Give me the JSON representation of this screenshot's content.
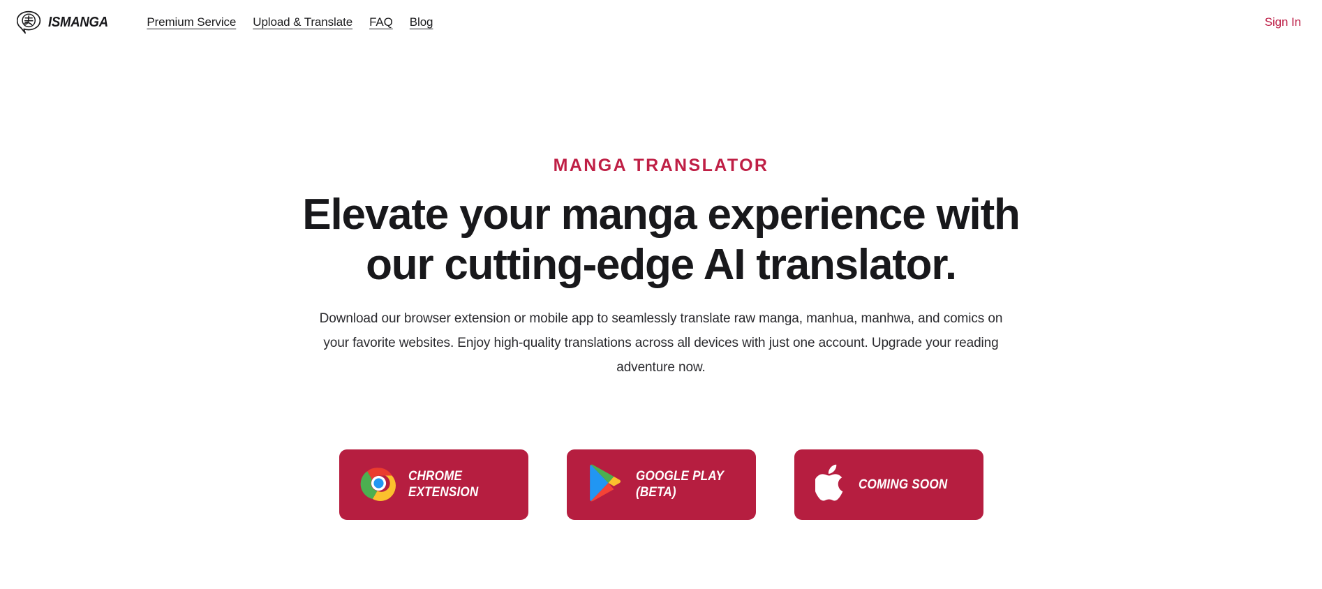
{
  "header": {
    "brand": {
      "mark_icon": "speech-bubble-manga-icon",
      "mark_char": "ま",
      "name": "ISMANGA"
    },
    "nav": [
      {
        "label": "Premium Service",
        "name": "nav-link-premium-service"
      },
      {
        "label": "Upload & Translate",
        "name": "nav-link-upload-translate"
      },
      {
        "label": "FAQ",
        "name": "nav-link-faq"
      },
      {
        "label": "Blog",
        "name": "nav-link-blog"
      }
    ],
    "signin_label": "Sign In"
  },
  "hero": {
    "eyebrow": "MANGA TRANSLATOR",
    "title": "Elevate your manga experience with our cutting-edge AI translator.",
    "subtitle": "Download our browser extension or mobile app to seamlessly translate raw manga, manhua, manhwa, and comics on your favorite websites. Enjoy high-quality translations across all devices with just one account. Upgrade your reading adventure now."
  },
  "cta": {
    "buttons": [
      {
        "label": "CHROME\nEXTENSION",
        "icon": "chrome-logo-icon"
      },
      {
        "label": "GOOGLE PLAY\n(BETA)",
        "icon": "google-play-logo-icon"
      },
      {
        "label": "COMING SOON",
        "icon": "apple-logo-icon"
      }
    ]
  },
  "colors": {
    "brand_red": "#b61e40",
    "eyebrow_red": "#bf1f45",
    "signin_red": "#bd1f47",
    "text_dark": "#18181b",
    "page_background": "#ffffff"
  }
}
